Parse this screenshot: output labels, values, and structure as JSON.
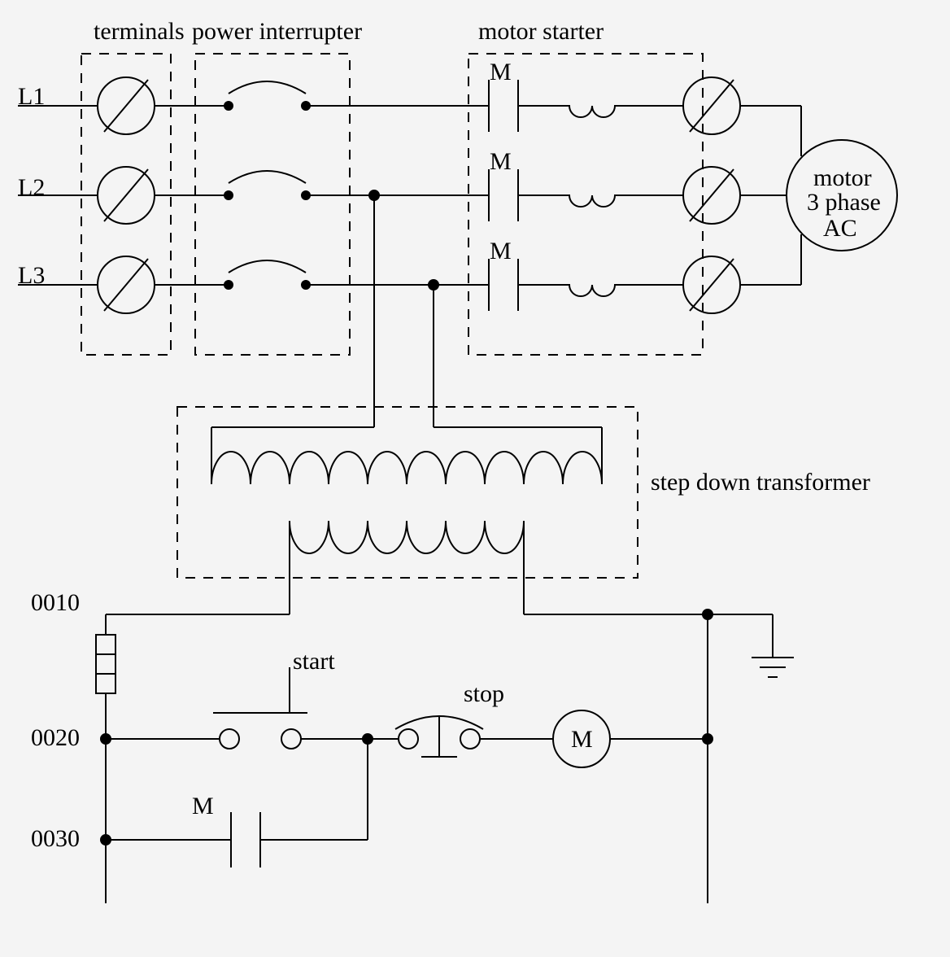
{
  "labels": {
    "terminals": "terminals",
    "power_interrupter": "power interrupter",
    "motor_starter": "motor starter",
    "L1": "L1",
    "L2": "L2",
    "L3": "L3",
    "M1": "M",
    "M2": "M",
    "M3": "M",
    "motor": "motor",
    "three_phase": "3 phase",
    "AC": "AC",
    "step_down_transformer": "step down transformer",
    "r0010": "0010",
    "r0020": "0020",
    "r0030": "0030",
    "start": "start",
    "stop": "stop",
    "coilM": "M",
    "contactM": "M"
  }
}
